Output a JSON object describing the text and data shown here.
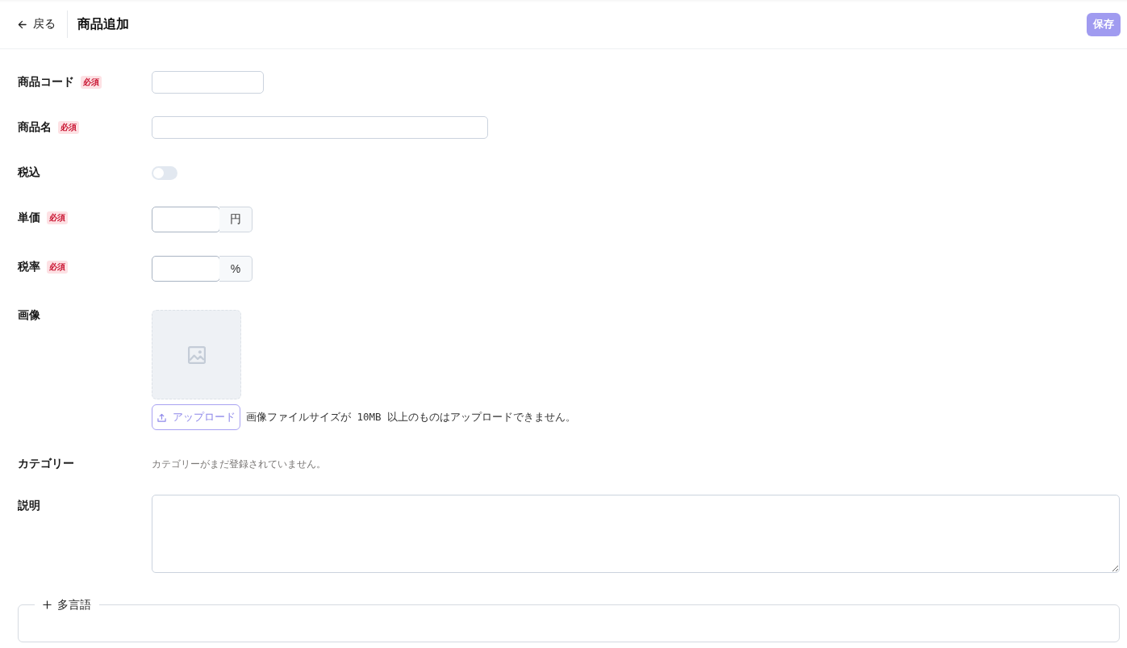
{
  "header": {
    "back_button": {
      "label": "戻る"
    },
    "title": "商品追加",
    "save_button": {
      "label": "保存",
      "disabled": true
    }
  },
  "fields": [
    {
      "kind": "short_input",
      "label": "商品コード",
      "badge": "必須"
    },
    {
      "kind": "input",
      "label": "商品名",
      "badge": "必須"
    },
    {
      "kind": "toggle",
      "label": "税込",
      "on": false
    },
    {
      "kind": "unit_input",
      "label": "単価",
      "badge": "必須",
      "unit": "円"
    },
    {
      "kind": "unit_input",
      "label": "税率",
      "badge": "必須",
      "unit": "%"
    },
    {
      "kind": "image",
      "label": "画像",
      "upload_button": "アップロード",
      "note": "画像ファイルサイズが 10MB 以上のものはアップロードできません。"
    },
    {
      "kind": "category",
      "label": "カテゴリー",
      "empty_message": "カテゴリーがまだ登録されていません。"
    },
    {
      "kind": "textarea",
      "label": "説明"
    }
  ],
  "multilingual": {
    "label": "多言語"
  }
}
